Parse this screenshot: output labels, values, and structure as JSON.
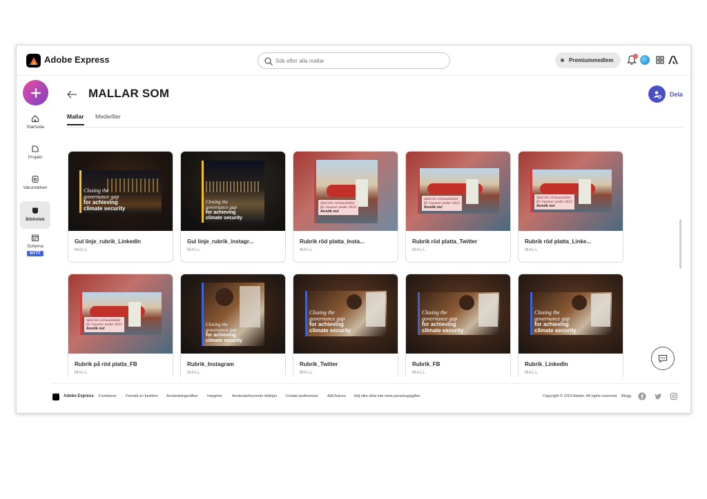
{
  "app": {
    "title": "Adobe Express"
  },
  "search": {
    "placeholder": "Sök efter alla mallar"
  },
  "header": {
    "premium_label": "Premiummedlem",
    "notification_count": "2"
  },
  "sidebar": {
    "items": [
      {
        "label": "Startsida",
        "icon": "home-icon"
      },
      {
        "label": "Projekt",
        "icon": "folder-icon"
      },
      {
        "label": "Varumärken",
        "icon": "brand-icon"
      },
      {
        "label": "Bibliotek",
        "icon": "library-icon",
        "active": true
      },
      {
        "label": "Schema",
        "icon": "calendar-icon",
        "badge": "NYTT"
      }
    ]
  },
  "page": {
    "title": "MALLAR SOM",
    "share_label": "Dela"
  },
  "tabs": [
    {
      "label": "Mallar",
      "active": true
    },
    {
      "label": "Mediefiler"
    }
  ],
  "cards": [
    {
      "title": "Gul linje_rubrik_LinkedIn",
      "subtitle": "MALL",
      "art": {
        "lines": [
          "Closing the",
          "governance gap"
        ],
        "bold": [
          "for achieving",
          "climate security"
        ]
      }
    },
    {
      "title": "Gul linje_rubrik_instagr...",
      "subtitle": "MALL",
      "art": {
        "lines": [
          "Closing the",
          "governance gap"
        ],
        "bold": [
          "for achieving",
          "climate security"
        ]
      }
    },
    {
      "title": "Rubrik röd platta_Insta...",
      "subtitle": "MALL",
      "art": {
        "lines": [
          "Stöd till civilsamhället",
          "för insatser under 2023"
        ],
        "bold": [
          "Ansök nu!"
        ]
      }
    },
    {
      "title": "Rubrik röd platta_Twitter",
      "subtitle": "MALL",
      "art": {
        "lines": [
          "Stöd till civilsamhället",
          "för insatser under 2023"
        ],
        "bold": [
          "Ansök nu!"
        ]
      }
    },
    {
      "title": "Rubrik röd platta_Linke...",
      "subtitle": "MALL",
      "art": {
        "lines": [
          "Stöd till civilsamhället",
          "för insatser under 2023"
        ],
        "bold": [
          "Ansök nu!"
        ]
      }
    },
    {
      "title": "Rubrik på röd platta_FB",
      "subtitle": "MALL",
      "art": {
        "lines": [
          "Stöd till civilsamhället",
          "för insatser under 2023"
        ],
        "bold": [
          "Ansök nu!"
        ]
      }
    },
    {
      "title": "Rubrik_Instagram",
      "subtitle": "MALL",
      "art": {
        "lines": [
          "Closing the",
          "governance gap"
        ],
        "bold": [
          "for achieving",
          "climate security"
        ]
      }
    },
    {
      "title": "Rubrik_Twitter",
      "subtitle": "MALL",
      "art": {
        "lines": [
          "Closing the",
          "governance gap"
        ],
        "bold": [
          "for achieving",
          "climate security"
        ]
      }
    },
    {
      "title": "Rubrik_FB",
      "subtitle": "MALL",
      "art": {
        "lines": [
          "Closing the",
          "governance gap"
        ],
        "bold": [
          "for achieving",
          "climate security"
        ]
      }
    },
    {
      "title": "Rubrik_LinkedIn",
      "subtitle": "MALL",
      "art": {
        "lines": [
          "Closing the",
          "governance gap"
        ],
        "bold": [
          "for achieving",
          "climate security"
        ]
      }
    }
  ],
  "footer": {
    "brand": "Adobe Express",
    "links": [
      "Funktioner",
      "Föreslå en funktion",
      "Användningsvillkor",
      "Integritet",
      "Användarforumets riktlinjer",
      "Cookie-preferenser",
      "AdChoices",
      "Sälj eller dela inte mina personuppgifter"
    ],
    "copyright": "Copyright © 2023 Adobe. All rights reserved.",
    "blog": "Blogg"
  },
  "colors": {
    "accent": "#4b4fc4",
    "yellow_line": "#f2c230",
    "blue_line": "#3e63d6",
    "red_line": "#d63a3a",
    "nytt_badge": "#3e63d6"
  }
}
